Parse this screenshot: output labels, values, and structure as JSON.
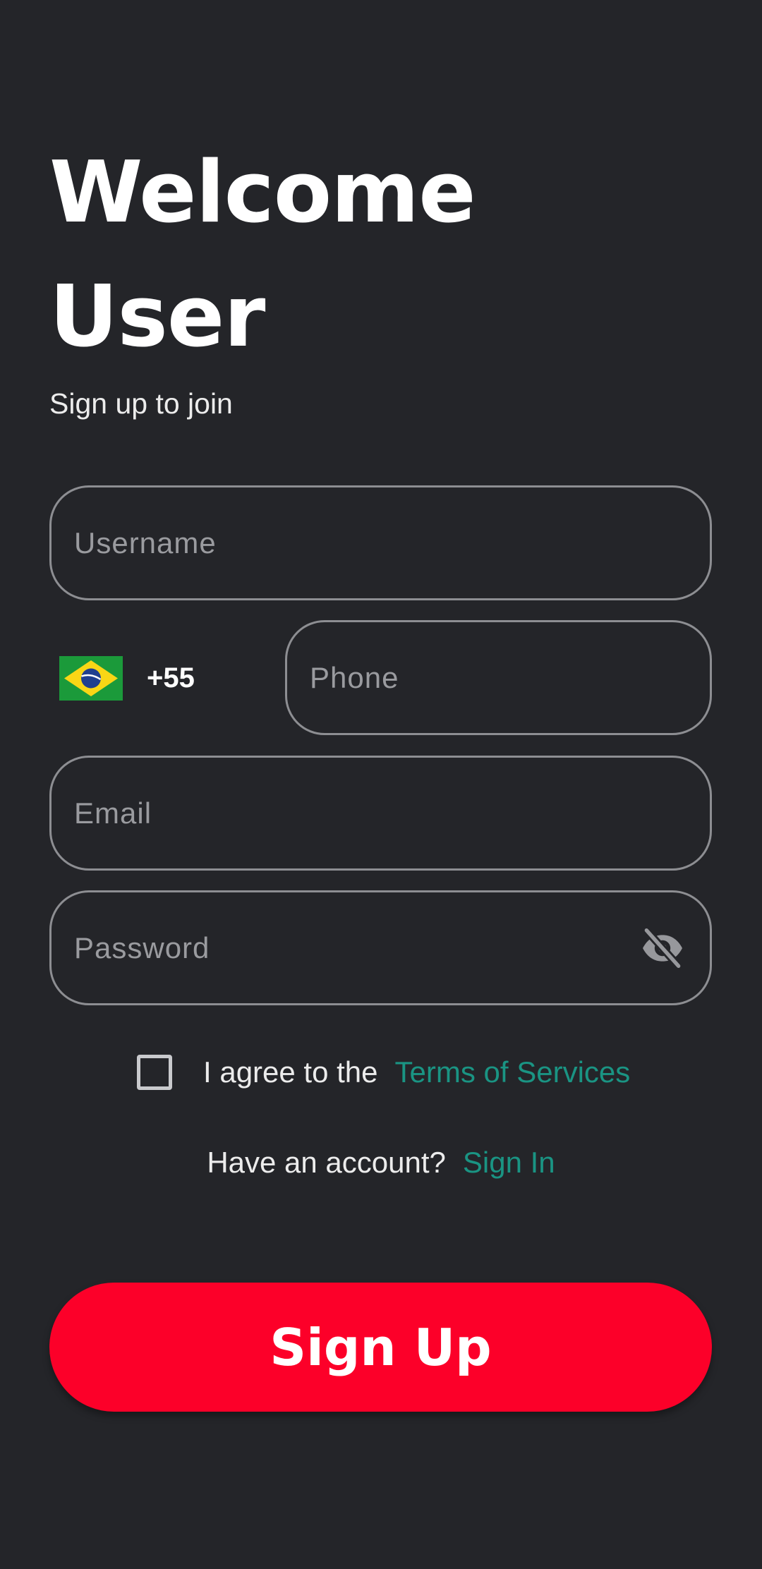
{
  "header": {
    "title_line1": "Welcome",
    "title_line2": "User",
    "subtitle": "Sign up to join"
  },
  "form": {
    "username": {
      "placeholder": "Username",
      "value": ""
    },
    "country": {
      "flag_icon": "brazil-flag-icon",
      "dial_code": "+55"
    },
    "phone": {
      "placeholder": "Phone",
      "value": ""
    },
    "email": {
      "placeholder": "Email",
      "value": ""
    },
    "password": {
      "placeholder": "Password",
      "value": "",
      "toggle_icon": "eye-off-icon"
    },
    "agree": {
      "checked": false,
      "text": "I agree to the",
      "link": "Terms of Services"
    },
    "account": {
      "text": "Have an account?",
      "link": "Sign In"
    },
    "submit_label": "Sign Up"
  },
  "colors": {
    "background": "#242529",
    "accent_link": "#1a9483",
    "primary_button": "#fc0029",
    "field_border": "#8d8e92"
  }
}
